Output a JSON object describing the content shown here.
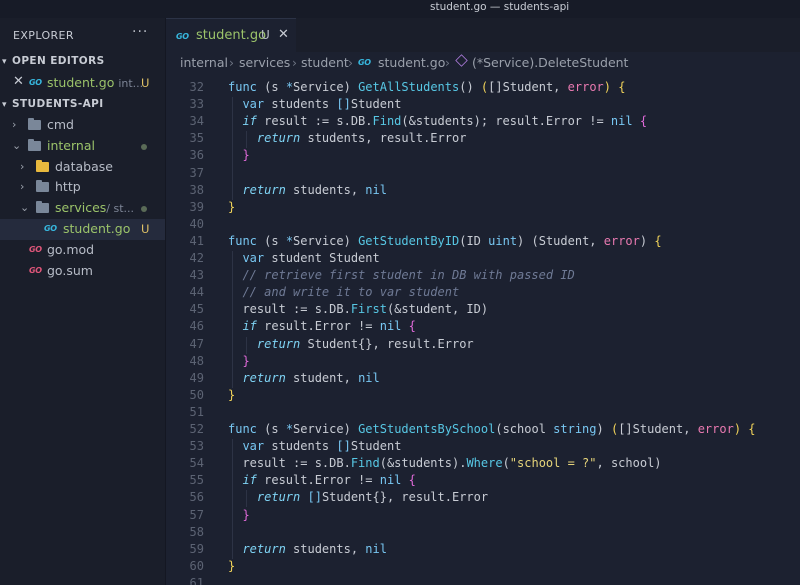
{
  "window": {
    "title": "student.go — students-api"
  },
  "sidebar": {
    "header": "EXPLORER",
    "more": "···",
    "open_editors": {
      "label": "OPEN EDITORS",
      "items": [
        {
          "name": "student.go",
          "suffix": "int...",
          "badge": "U"
        }
      ]
    },
    "project": {
      "label": "STUDENTS-API",
      "tree": [
        {
          "name": "cmd"
        },
        {
          "name": "internal"
        },
        {
          "name": "database"
        },
        {
          "name": "http"
        },
        {
          "name": "services",
          "suffix": "/ st..."
        },
        {
          "name": "student.go",
          "badge": "U"
        },
        {
          "name": "go.mod"
        },
        {
          "name": "go.sum"
        }
      ]
    }
  },
  "tabs": [
    {
      "label": "student.go",
      "badge": "U",
      "close": "✕"
    }
  ],
  "breadcrumb": [
    "internal",
    "services",
    "student",
    "student.go",
    "(*Service).DeleteStudent"
  ],
  "editor": {
    "lines": [
      {
        "n": "32",
        "tokens": [
          [
            "kw",
            "func "
          ],
          [
            "op",
            "(s "
          ],
          [
            "kw",
            "*"
          ],
          [
            "op",
            "Service) "
          ],
          [
            "fn",
            "GetAllStudents"
          ],
          [
            "op",
            "() "
          ],
          [
            "brk",
            "("
          ],
          [
            "op",
            "[]Student, "
          ],
          [
            "ty",
            "error"
          ],
          [
            "brk",
            ") "
          ],
          [
            "brk",
            "{"
          ]
        ]
      },
      {
        "n": "33",
        "tokens": [
          [
            "kw",
            "  var "
          ],
          [
            "op",
            "students "
          ],
          [
            "kw",
            "[]"
          ],
          [
            "op",
            "Student"
          ]
        ]
      },
      {
        "n": "34",
        "tokens": [
          [
            "ctl",
            "  if "
          ],
          [
            "op",
            "result := s.DB."
          ],
          [
            "fn",
            "Find"
          ],
          [
            "op",
            "(&students); result.Error != "
          ],
          [
            "kw",
            "nil "
          ],
          [
            "brk2",
            "{"
          ]
        ]
      },
      {
        "n": "35",
        "tokens": [
          [
            "ctl",
            "    return "
          ],
          [
            "op",
            "students, result.Error"
          ]
        ]
      },
      {
        "n": "36",
        "tokens": [
          [
            "brk2",
            "  }"
          ]
        ]
      },
      {
        "n": "37",
        "tokens": []
      },
      {
        "n": "38",
        "tokens": [
          [
            "ctl",
            "  return "
          ],
          [
            "op",
            "students, "
          ],
          [
            "kw",
            "nil"
          ]
        ]
      },
      {
        "n": "39",
        "tokens": [
          [
            "brk",
            "}"
          ]
        ]
      },
      {
        "n": "40",
        "tokens": []
      },
      {
        "n": "41",
        "tokens": [
          [
            "kw",
            "func "
          ],
          [
            "op",
            "(s "
          ],
          [
            "kw",
            "*"
          ],
          [
            "op",
            "Service) "
          ],
          [
            "fn",
            "GetStudentByID"
          ],
          [
            "op",
            "(ID "
          ],
          [
            "kw",
            "uint"
          ],
          [
            "op",
            ") (Student, "
          ],
          [
            "ty",
            "error"
          ],
          [
            "op",
            ") "
          ],
          [
            "brk",
            "{"
          ]
        ]
      },
      {
        "n": "42",
        "tokens": [
          [
            "kw",
            "  var "
          ],
          [
            "op",
            "student Student"
          ]
        ]
      },
      {
        "n": "43",
        "tokens": [
          [
            "cm",
            "  // retrieve first student in DB with passed ID"
          ]
        ]
      },
      {
        "n": "44",
        "tokens": [
          [
            "cm",
            "  // and write it to var student"
          ]
        ]
      },
      {
        "n": "45",
        "tokens": [
          [
            "op",
            "  result := s.DB."
          ],
          [
            "fn",
            "First"
          ],
          [
            "op",
            "(&student, ID)"
          ]
        ]
      },
      {
        "n": "46",
        "tokens": [
          [
            "ctl",
            "  if "
          ],
          [
            "op",
            "result.Error != "
          ],
          [
            "kw",
            "nil "
          ],
          [
            "brk2",
            "{"
          ]
        ]
      },
      {
        "n": "47",
        "tokens": [
          [
            "ctl",
            "    return "
          ],
          [
            "op",
            "Student{}, result.Error"
          ]
        ]
      },
      {
        "n": "48",
        "tokens": [
          [
            "brk2",
            "  }"
          ]
        ]
      },
      {
        "n": "49",
        "tokens": [
          [
            "ctl",
            "  return "
          ],
          [
            "op",
            "student, "
          ],
          [
            "kw",
            "nil"
          ]
        ]
      },
      {
        "n": "50",
        "tokens": [
          [
            "brk",
            "}"
          ]
        ]
      },
      {
        "n": "51",
        "tokens": []
      },
      {
        "n": "52",
        "tokens": [
          [
            "kw",
            "func "
          ],
          [
            "op",
            "(s "
          ],
          [
            "kw",
            "*"
          ],
          [
            "op",
            "Service) "
          ],
          [
            "fn",
            "GetStudentsBySchool"
          ],
          [
            "op",
            "(school "
          ],
          [
            "kw",
            "string"
          ],
          [
            "op",
            ") "
          ],
          [
            "brk",
            "("
          ],
          [
            "op",
            "[]Student, "
          ],
          [
            "ty",
            "error"
          ],
          [
            "brk",
            ") "
          ],
          [
            "brk",
            "{"
          ]
        ]
      },
      {
        "n": "53",
        "tokens": [
          [
            "kw",
            "  var "
          ],
          [
            "op",
            "students "
          ],
          [
            "kw",
            "[]"
          ],
          [
            "op",
            "Student"
          ]
        ]
      },
      {
        "n": "54",
        "tokens": [
          [
            "op",
            "  result := s.DB."
          ],
          [
            "fn",
            "Find"
          ],
          [
            "op",
            "(&students)."
          ],
          [
            "fn",
            "Where"
          ],
          [
            "op",
            "("
          ],
          [
            "str",
            "\"school = ?\""
          ],
          [
            "op",
            ", school)"
          ]
        ]
      },
      {
        "n": "55",
        "tokens": [
          [
            "ctl",
            "  if "
          ],
          [
            "op",
            "result.Error != "
          ],
          [
            "kw",
            "nil "
          ],
          [
            "brk2",
            "{"
          ]
        ]
      },
      {
        "n": "56",
        "tokens": [
          [
            "ctl",
            "    return "
          ],
          [
            "kw",
            "[]"
          ],
          [
            "op",
            "Student{}, result.Error"
          ]
        ]
      },
      {
        "n": "57",
        "tokens": [
          [
            "brk2",
            "  }"
          ]
        ]
      },
      {
        "n": "58",
        "tokens": []
      },
      {
        "n": "59",
        "tokens": [
          [
            "ctl",
            "  return "
          ],
          [
            "op",
            "students, "
          ],
          [
            "kw",
            "nil"
          ]
        ]
      },
      {
        "n": "60",
        "tokens": [
          [
            "brk",
            "}"
          ]
        ]
      },
      {
        "n": "61",
        "tokens": []
      }
    ]
  },
  "colors": {
    "accent": "#9bc36a",
    "background": "#1c2130",
    "sidebar": "#1a1e2a",
    "go_icon": "#37b7de",
    "modified": "#e0c266"
  }
}
